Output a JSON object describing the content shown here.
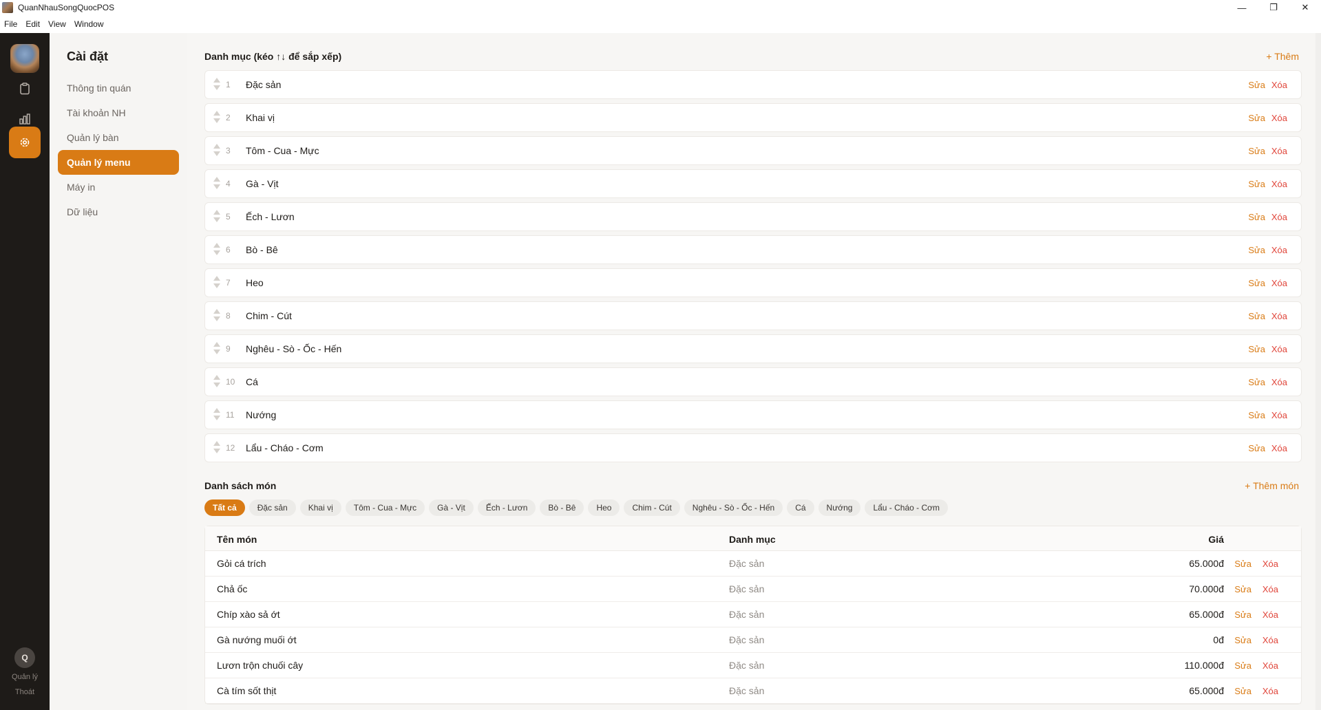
{
  "window": {
    "title": "QuanNhauSongQuocPOS",
    "controls": {
      "minimize": "—",
      "maximize": "❐",
      "close": "✕"
    }
  },
  "menu": [
    "File",
    "Edit",
    "View",
    "Window"
  ],
  "rail": {
    "icons": [
      "clipboard-icon",
      "bar-chart-icon",
      "gear-icon"
    ],
    "active": "gear-icon",
    "user_initial": "Q",
    "user_role": "Quản lý",
    "logout": "Thoát"
  },
  "settings": {
    "title": "Cài đặt",
    "items": [
      {
        "label": "Thông tin quán",
        "active": false
      },
      {
        "label": "Tài khoản NH",
        "active": false
      },
      {
        "label": "Quản lý bàn",
        "active": false
      },
      {
        "label": "Quản lý menu",
        "active": true
      },
      {
        "label": "Máy in",
        "active": false
      },
      {
        "label": "Dữ liệu",
        "active": false
      }
    ]
  },
  "categories": {
    "title": "Danh mục (kéo ↑↓ để sắp xếp)",
    "add_label": "+ Thêm",
    "edit_label": "Sửa",
    "delete_label": "Xóa",
    "items": [
      {
        "idx": "1",
        "name": "Đặc sản"
      },
      {
        "idx": "2",
        "name": "Khai vị"
      },
      {
        "idx": "3",
        "name": "Tôm - Cua - Mực"
      },
      {
        "idx": "4",
        "name": "Gà - Vịt"
      },
      {
        "idx": "5",
        "name": "Ếch - Lươn"
      },
      {
        "idx": "6",
        "name": "Bò - Bê"
      },
      {
        "idx": "7",
        "name": "Heo"
      },
      {
        "idx": "8",
        "name": "Chim - Cút"
      },
      {
        "idx": "9",
        "name": "Nghêu - Sò - Ốc - Hến"
      },
      {
        "idx": "10",
        "name": "Cá"
      },
      {
        "idx": "11",
        "name": "Nướng"
      },
      {
        "idx": "12",
        "name": "Lẩu - Cháo - Cơm"
      }
    ]
  },
  "dishes": {
    "title": "Danh sách món",
    "add_label": "+ Thêm món",
    "filters": [
      {
        "label": "Tất cả",
        "active": true
      },
      {
        "label": "Đặc sản",
        "active": false
      },
      {
        "label": "Khai vị",
        "active": false
      },
      {
        "label": "Tôm - Cua - Mực",
        "active": false
      },
      {
        "label": "Gà - Vịt",
        "active": false
      },
      {
        "label": "Ếch - Lươn",
        "active": false
      },
      {
        "label": "Bò - Bê",
        "active": false
      },
      {
        "label": "Heo",
        "active": false
      },
      {
        "label": "Chim - Cút",
        "active": false
      },
      {
        "label": "Nghêu - Sò - Ốc - Hến",
        "active": false
      },
      {
        "label": "Cá",
        "active": false
      },
      {
        "label": "Nướng",
        "active": false
      },
      {
        "label": "Lẩu - Cháo - Cơm",
        "active": false
      }
    ],
    "columns": {
      "name": "Tên món",
      "category": "Danh mục",
      "price": "Giá"
    },
    "edit_label": "Sửa",
    "delete_label": "Xóa",
    "rows": [
      {
        "name": "Gỏi cá trích",
        "category": "Đặc sản",
        "price": "65.000đ"
      },
      {
        "name": "Chả ốc",
        "category": "Đặc sản",
        "price": "70.000đ"
      },
      {
        "name": "Chíp xào sả ớt",
        "category": "Đặc sản",
        "price": "65.000đ"
      },
      {
        "name": "Gà nướng muối ớt",
        "category": "Đặc sản",
        "price": "0đ"
      },
      {
        "name": "Lươn trộn chuối cây",
        "category": "Đặc sản",
        "price": "110.000đ"
      },
      {
        "name": "Cà tím sốt thịt",
        "category": "Đặc sản",
        "price": "65.000đ"
      }
    ]
  },
  "colors": {
    "accent": "#d97b15",
    "danger": "#e0453a",
    "rail_bg": "#1e1b18",
    "sidebar_bg": "#f6f5f3",
    "main_bg": "#f7f6f4"
  }
}
